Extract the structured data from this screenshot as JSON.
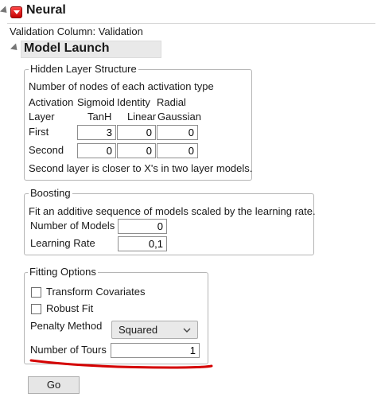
{
  "window": {
    "title": "Neural",
    "validation_label": "Validation Column: Validation"
  },
  "model_launch": {
    "title": "Model Launch"
  },
  "hidden_layer": {
    "title": "Hidden Layer Structure",
    "description": "Number of nodes of each activation type",
    "activation_label": "Activation",
    "layer_label": "Layer",
    "columns": [
      {
        "name": "Sigmoid",
        "sub": "TanH"
      },
      {
        "name": "Identity",
        "sub": "Linear"
      },
      {
        "name": "Radial",
        "sub": "Gaussian"
      }
    ],
    "rows": [
      {
        "label": "First",
        "values": [
          "3",
          "0",
          "0"
        ]
      },
      {
        "label": "Second",
        "values": [
          "0",
          "0",
          "0"
        ]
      }
    ],
    "note": "Second layer is closer to X's in two layer models."
  },
  "boosting": {
    "title": "Boosting",
    "description": "Fit an additive sequence of models scaled by the learning rate.",
    "num_models_label": "Number of Models",
    "num_models_value": "0",
    "learning_rate_label": "Learning Rate",
    "learning_rate_value": "0,1"
  },
  "fitting": {
    "title": "Fitting Options",
    "transform_label": "Transform Covariates",
    "robust_label": "Robust Fit",
    "penalty_label": "Penalty Method",
    "penalty_value": "Squared",
    "tours_label": "Number of Tours",
    "tours_value": "1"
  },
  "go_button": "Go",
  "colors": {
    "annotation_line": "#d40000",
    "red_button": "#e00000"
  },
  "icons": [
    "disclosure-triangle-icon",
    "red-triangle-menu-icon",
    "chevron-down-icon"
  ]
}
